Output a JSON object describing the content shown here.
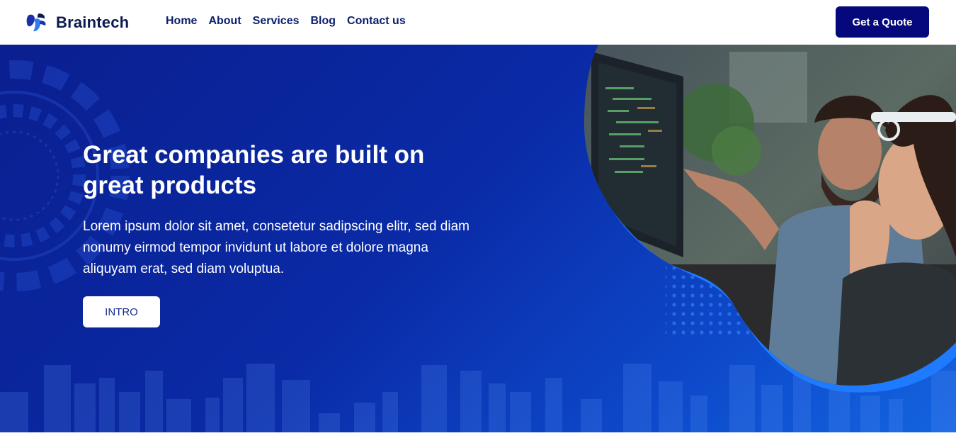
{
  "brand": {
    "name": "Braintech"
  },
  "nav": {
    "items": [
      {
        "label": "Home"
      },
      {
        "label": "About"
      },
      {
        "label": "Services"
      },
      {
        "label": "Blog"
      },
      {
        "label": "Contact us"
      }
    ],
    "cta_label": "Get a Quote"
  },
  "hero": {
    "title_line1": "Great companies are built on",
    "title_line2": "great products",
    "body": "Lorem ipsum dolor sit amet, consetetur sadipscing elitr, sed diam nonumy eirmod tempor invidunt ut labore et dolore magna aliquyam erat, sed diam voluptua.",
    "button_label": "INTRO",
    "image_subject": "two developers looking at code on monitors"
  },
  "colors": {
    "nav_text": "#0b1f6b",
    "cta_bg": "#05087a",
    "hero_bg_start": "#0a1f8f",
    "hero_bg_end": "#1364e0",
    "accent_ring": "#1e7bff"
  }
}
